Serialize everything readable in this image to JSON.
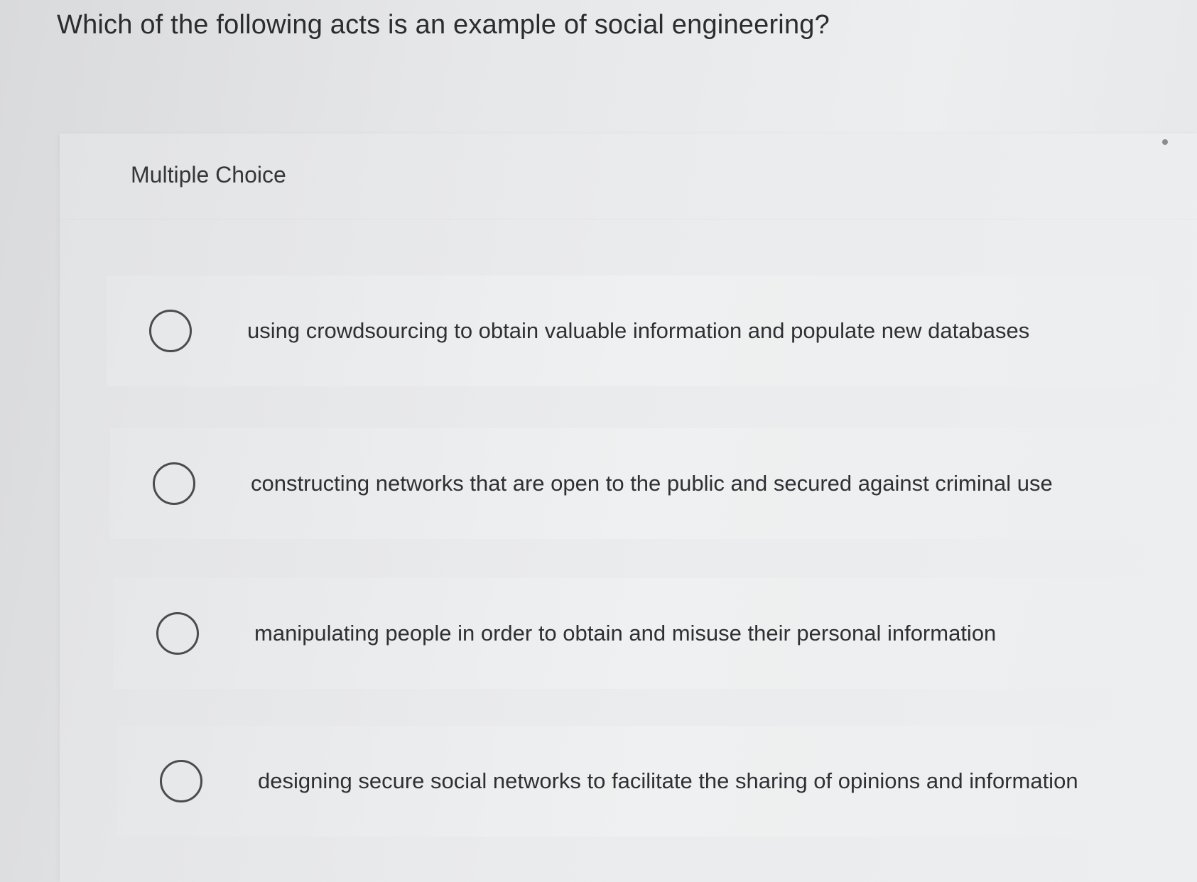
{
  "question": {
    "text": "Which of the following acts is an example of social engineering?"
  },
  "question_type": "Multiple Choice",
  "options": [
    {
      "label": "using crowdsourcing to obtain valuable information and populate new databases",
      "selected": false
    },
    {
      "label": "constructing networks that are open to the public and secured against criminal use",
      "selected": false
    },
    {
      "label": "manipulating people in order to obtain and misuse their personal information",
      "selected": false
    },
    {
      "label": "designing secure social networks to facilitate the sharing of opinions and information",
      "selected": false
    }
  ]
}
